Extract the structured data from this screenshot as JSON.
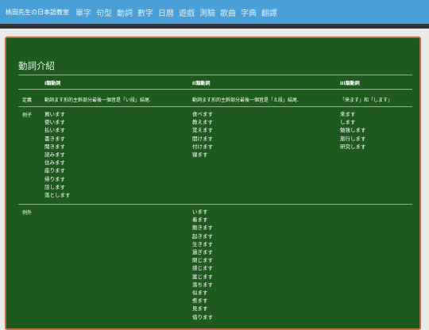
{
  "header": {
    "brand": "桃田先生の日本語教室",
    "nav": [
      "單字",
      "句型",
      "動詞",
      "數字",
      "日曆",
      "遊戲",
      "測驗",
      "歌曲",
      "字典",
      "翻譯"
    ]
  },
  "board": {
    "title": "動詞介紹",
    "columns": [
      "I類動詞",
      "II類動詞",
      "III類動詞"
    ],
    "definition": {
      "label": "定義",
      "group1": "動詞ます形的主幹部分最後一個音是「い段」結尾.",
      "group2": "動詞ます形的主幹部分最後一個音是「え段」結尾.",
      "group3": "「来ます」和「します」"
    },
    "examples": {
      "label": "例子",
      "group1": [
        "買います",
        "使います",
        "払います",
        "書きます",
        "聞きます",
        "読みます",
        "住みます",
        "座ります",
        "帰ります",
        "話します",
        "落とします"
      ],
      "group2": [
        "食べます",
        "教えます",
        "覚えます",
        "開けます",
        "付けます",
        "寝ます"
      ],
      "group3": [
        "来ます",
        "します",
        "勉強します",
        "旅行します",
        "研究します"
      ]
    },
    "exceptions": {
      "label": "例外",
      "group2": [
        "います",
        "着ます",
        "飽きます",
        "起きます",
        "生きます",
        "過ぎます",
        "閉じます",
        "感じます",
        "案じます",
        "落ちます",
        "似ます",
        "煮ます",
        "見ます",
        "借ります"
      ]
    }
  }
}
